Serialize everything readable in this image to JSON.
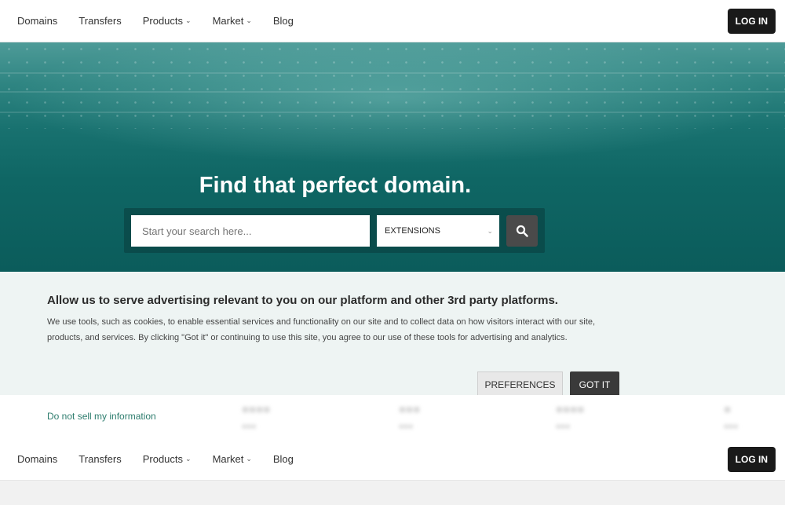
{
  "nav": {
    "links": [
      {
        "label": "Domains"
      },
      {
        "label": "Transfers"
      },
      {
        "label": "Products"
      },
      {
        "label": "Market"
      },
      {
        "label": "Blog"
      }
    ],
    "login_label": "LOG IN"
  },
  "hero": {
    "title": "Find that perfect domain.",
    "search_placeholder": "Start your search here...",
    "extensions_label": "EXTENSIONS"
  },
  "cookie": {
    "title": "Allow us to serve advertising relevant to you on our platform and other 3rd party platforms.",
    "body": "We use tools, such as cookies, to enable essential services and functionality on our site and to collect data on how visitors interact with our site, products, and services. By clicking \"Got it\" or continuing to use this site, you agree to our use of these tools for advertising and analytics.",
    "preferences_label": "PREFERENCES",
    "got_it_label": "GOT IT",
    "do_not_sell_label": "Do not sell my information"
  },
  "colors": {
    "accent_link": "#2e7d6e",
    "login_bg": "#1a1a1a",
    "hero_teal": "#0f6664"
  },
  "icons": {
    "search": "search-icon",
    "chevron": "chevron-down-icon"
  }
}
